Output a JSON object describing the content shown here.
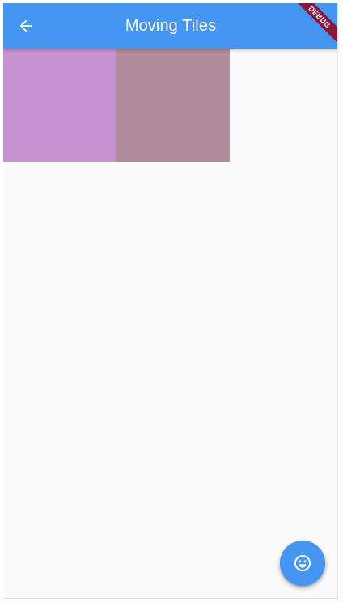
{
  "app_bar": {
    "title": "Moving Tiles",
    "color": "#4596f2",
    "back_icon": "arrow-back-icon"
  },
  "debug_banner": {
    "label": "DEBUG",
    "color": "#8b1a3a"
  },
  "tiles": [
    {
      "color": "#c792d1"
    },
    {
      "color": "#b18c9a"
    }
  ],
  "fab": {
    "icon": "smiley-face-icon",
    "color": "#4596f2"
  },
  "background_color": "#fafafa"
}
